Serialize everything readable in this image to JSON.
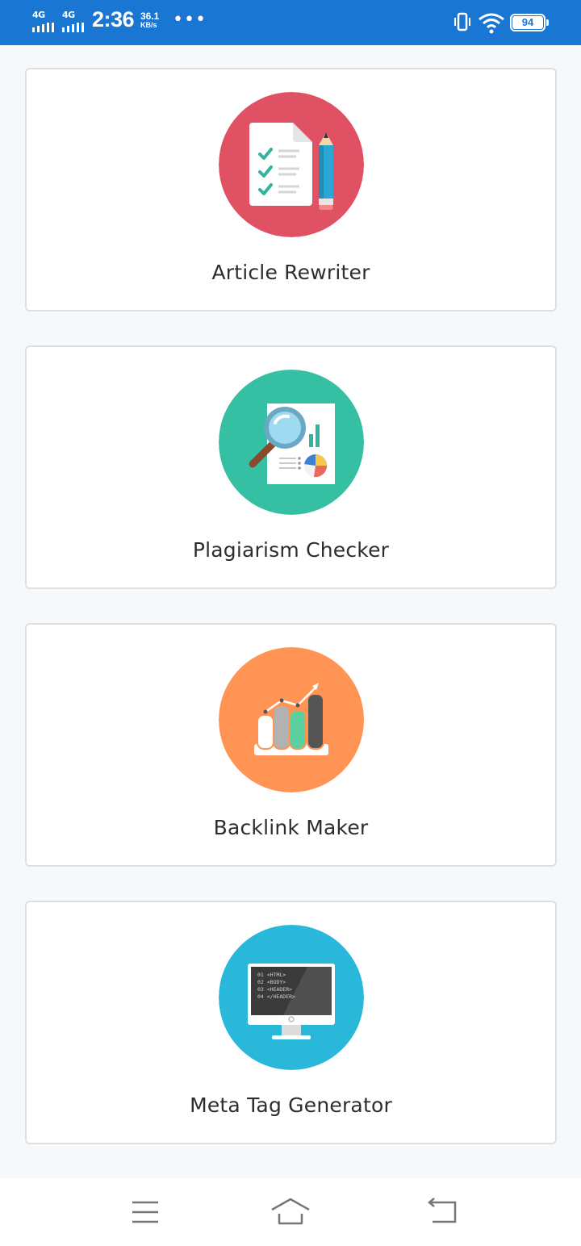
{
  "status_bar": {
    "network_1": "4G",
    "network_2": "4G",
    "time": "2:36",
    "speed_value": "36.1",
    "speed_unit": "KB/s",
    "more": "•••",
    "battery": "94",
    "icons": [
      "signal-icon",
      "vibrate-icon",
      "wifi-icon",
      "battery-icon"
    ]
  },
  "tools": [
    {
      "label": "Article Rewriter",
      "icon": "article-rewriter-icon",
      "color": "#e05263"
    },
    {
      "label": "Plagiarism Checker",
      "icon": "plagiarism-checker-icon",
      "color": "#35bfa3"
    },
    {
      "label": "Backlink Maker",
      "icon": "backlink-maker-icon",
      "color": "#ff9455"
    },
    {
      "label": "Meta Tag Generator",
      "icon": "meta-tag-generator-icon",
      "color": "#29b8d9"
    }
  ],
  "meta_code_lines": [
    "01 <HTML>",
    "02 <BODY>",
    "03 <HEADER>",
    "04 </HEADER>"
  ],
  "navigation": {
    "buttons": [
      "menu-icon",
      "home-icon",
      "back-icon"
    ]
  },
  "colors": {
    "status_bar": "#1976d2",
    "background": "#f7f8fa",
    "card_border": "#dcdfe3",
    "label_text": "#2d2d2d"
  }
}
